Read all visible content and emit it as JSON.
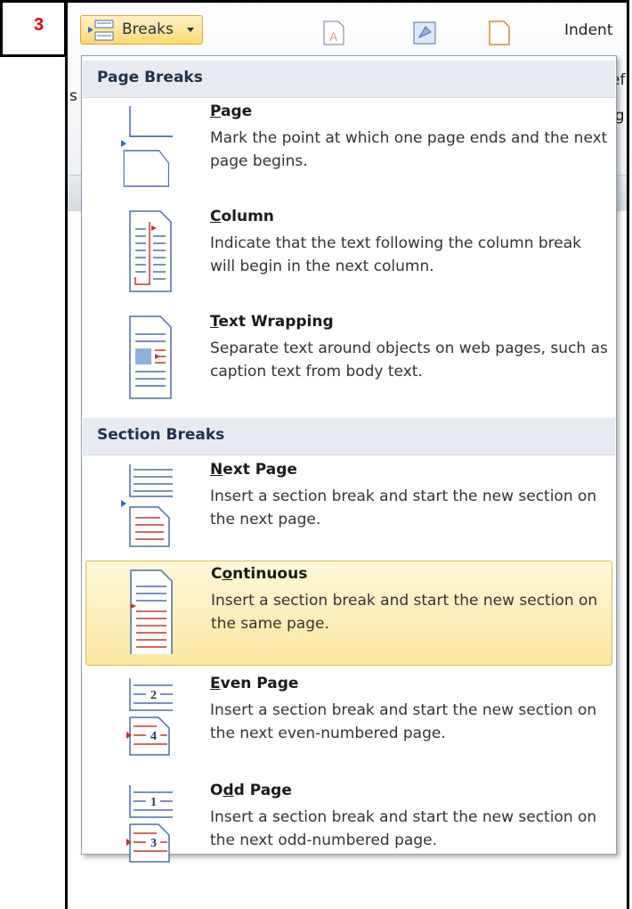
{
  "step_number": "3",
  "ribbon": {
    "breaks_label": "Breaks",
    "indent_label": "Indent",
    "fragments": [
      "s",
      "ef",
      "ig"
    ]
  },
  "menu": {
    "page_breaks_heading": "Page Breaks",
    "section_breaks_heading": "Section Breaks",
    "items": [
      {
        "first": "P",
        "rest": "age",
        "desc": "Mark the point at which one page ends and the next page begins."
      },
      {
        "first": "C",
        "rest": "olumn",
        "desc": "Indicate that the text following the column break will begin in the next column."
      },
      {
        "first": "T",
        "rest": "ext Wrapping",
        "desc": "Separate text around objects on web pages, such as caption text from body text."
      },
      {
        "first": "N",
        "rest": "ext Page",
        "desc": "Insert a section break and start the new section on the next page."
      },
      {
        "pre": "C",
        "first": "o",
        "rest": "ntinuous",
        "desc": "Insert a section break and start the new section on the same page."
      },
      {
        "first": "E",
        "rest": "ven Page",
        "desc": "Insert a section break and start the new section on the next even-numbered page."
      },
      {
        "pre": "O",
        "first": "d",
        "rest": "d Page",
        "desc": "Insert a section break and start the new section on the next odd-numbered page."
      }
    ],
    "even_numbers": [
      "2",
      "4"
    ],
    "odd_numbers": [
      "1",
      "3"
    ]
  },
  "colors": {
    "accent_red": "#c0392b",
    "blue_line": "#4a6fa5",
    "highlight": "#fbe6a2"
  }
}
